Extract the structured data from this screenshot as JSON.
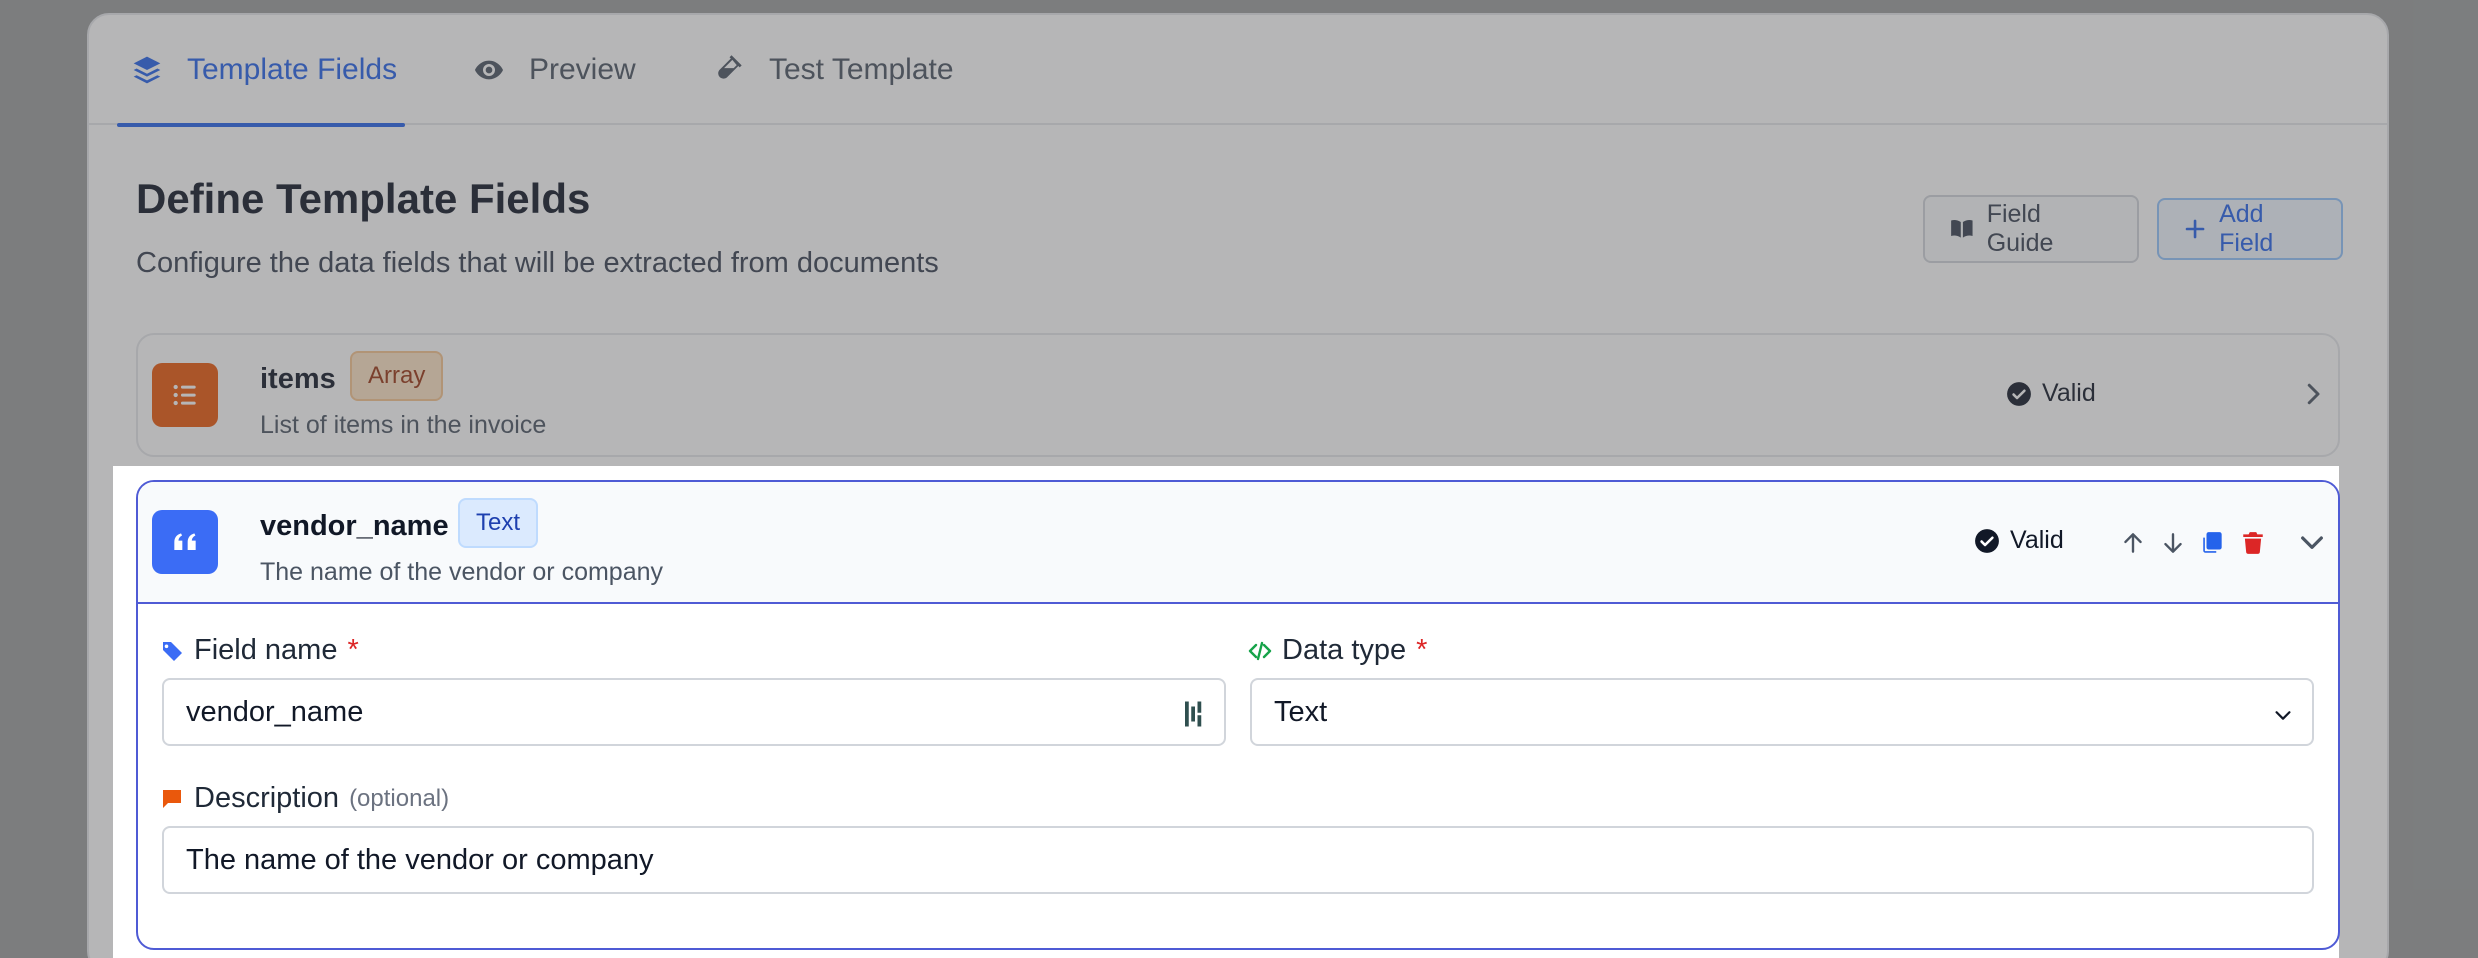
{
  "tabs": [
    {
      "label": "Template Fields",
      "icon": "layers-icon",
      "active": true
    },
    {
      "label": "Preview",
      "icon": "eye-icon"
    },
    {
      "label": "Test Template",
      "icon": "flask-icon"
    }
  ],
  "header": {
    "title": "Define Template Fields",
    "subtitle": "Configure the data fields that will be extracted from documents"
  },
  "toolbar": {
    "guide_label": "Field Guide",
    "add_label": "Add Field"
  },
  "fields": [
    {
      "name": "items",
      "type": "Array",
      "description": "List of items in the invoice",
      "status": "Valid",
      "icon": "list-icon",
      "icon_color": "#ea580c"
    },
    {
      "name": "vendor_name",
      "type": "Text",
      "description": "The name of the vendor or company",
      "status": "Valid",
      "icon": "quote-icon",
      "icon_color": "#3b6cf5"
    }
  ],
  "editor": {
    "field_name_label": "Field name",
    "field_name_value": "vendor_name",
    "data_type_label": "Data type",
    "data_type_value": "Text",
    "description_label": "Description",
    "description_optional": "(optional)",
    "description_value": "The name of the vendor or company",
    "required_mark": "*"
  },
  "colors": {
    "accent": "#2563eb",
    "focus_border": "#4f5bd5",
    "array_badge_bg": "#fde3c4",
    "text_badge_bg": "#dbeafe",
    "delete": "#dc2626"
  }
}
